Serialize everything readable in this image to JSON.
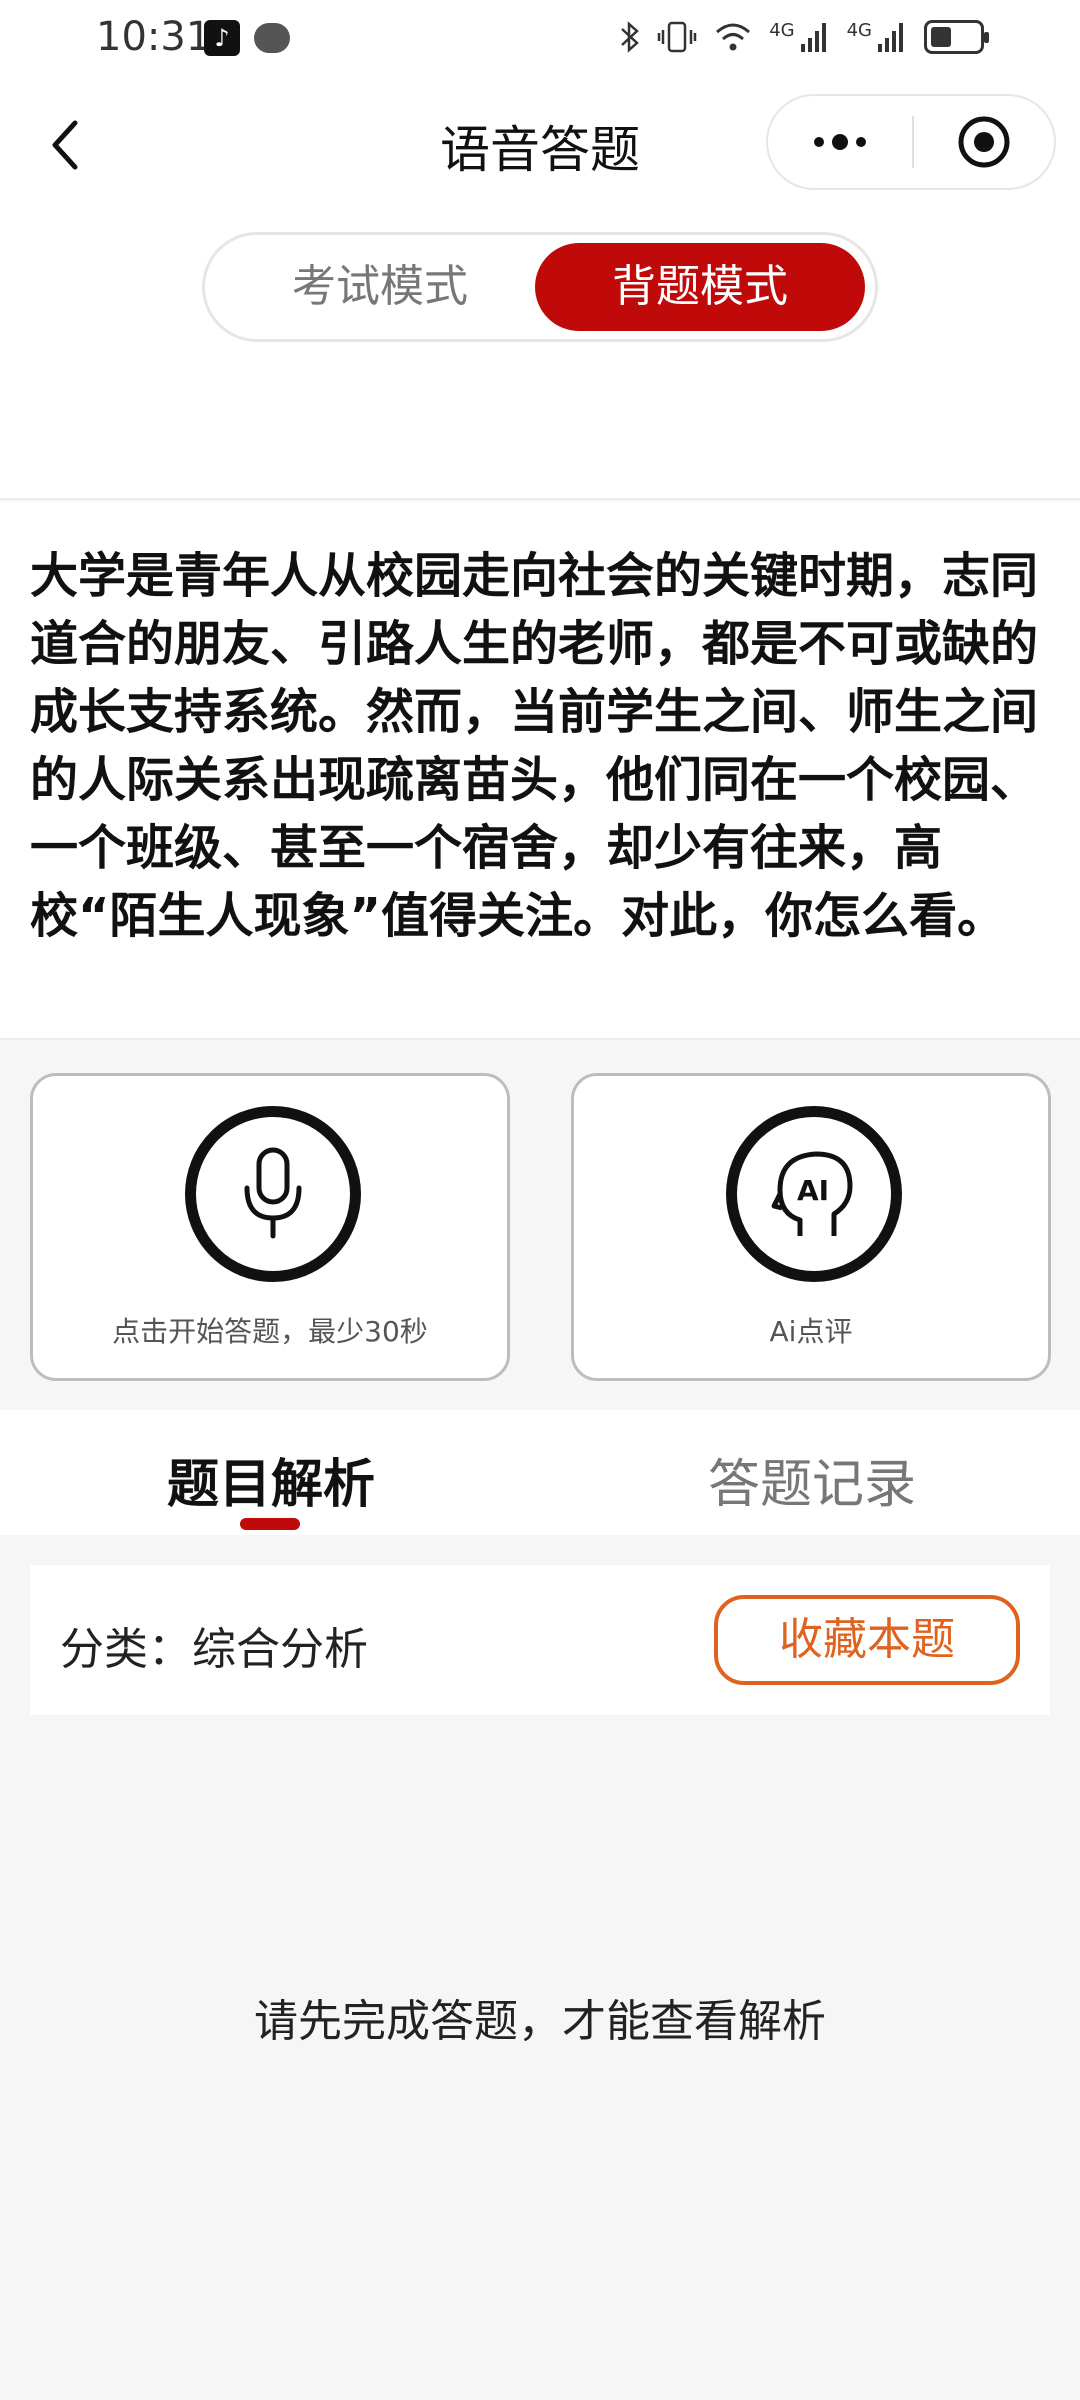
{
  "status_bar": {
    "time": "10:31",
    "network_1": "4G",
    "network_2": "4G",
    "left_icons": [
      "tiktok-icon",
      "chat-icon"
    ],
    "right_icons": [
      "bluetooth-icon",
      "vibrate-icon",
      "wifi-icon",
      "signal-icon",
      "signal-icon",
      "battery-icon"
    ]
  },
  "header": {
    "title": "语音答题",
    "back_icon": "chevron-left-icon",
    "more_icon": "more-dots-icon",
    "close_icon": "target-circle-icon"
  },
  "mode_toggle": {
    "exam_label": "考试模式",
    "recite_label": "背题模式",
    "selected": "背题模式"
  },
  "question": {
    "text": "大学是青年人从校园走向社会的关键时期，志同道合的朋友、引路人生的老师，都是不可或缺的成长支持系统。然而，当前学生之间、师生之间的人际关系出现疏离苗头，他们同在一个校园、一个班级、甚至一个宿舍，却少有往来，高校“陌生人现象”值得关注。对此，你怎么看。"
  },
  "actions": {
    "record": {
      "label": "点击开始答题，最少30秒",
      "icon": "microphone-icon"
    },
    "ai_review": {
      "label": "Ai点评",
      "icon": "ai-head-icon"
    }
  },
  "tabs": {
    "items": [
      {
        "label": "题目解析",
        "active": true
      },
      {
        "label": "答题记录",
        "active": false
      }
    ]
  },
  "category": {
    "text": "分类：综合分析",
    "collect_label": "收藏本题"
  },
  "notice": {
    "text": "请先完成答题，才能查看解析"
  },
  "colors": {
    "accent_red": "#c00a0a",
    "collect_orange": "#e0621f"
  }
}
